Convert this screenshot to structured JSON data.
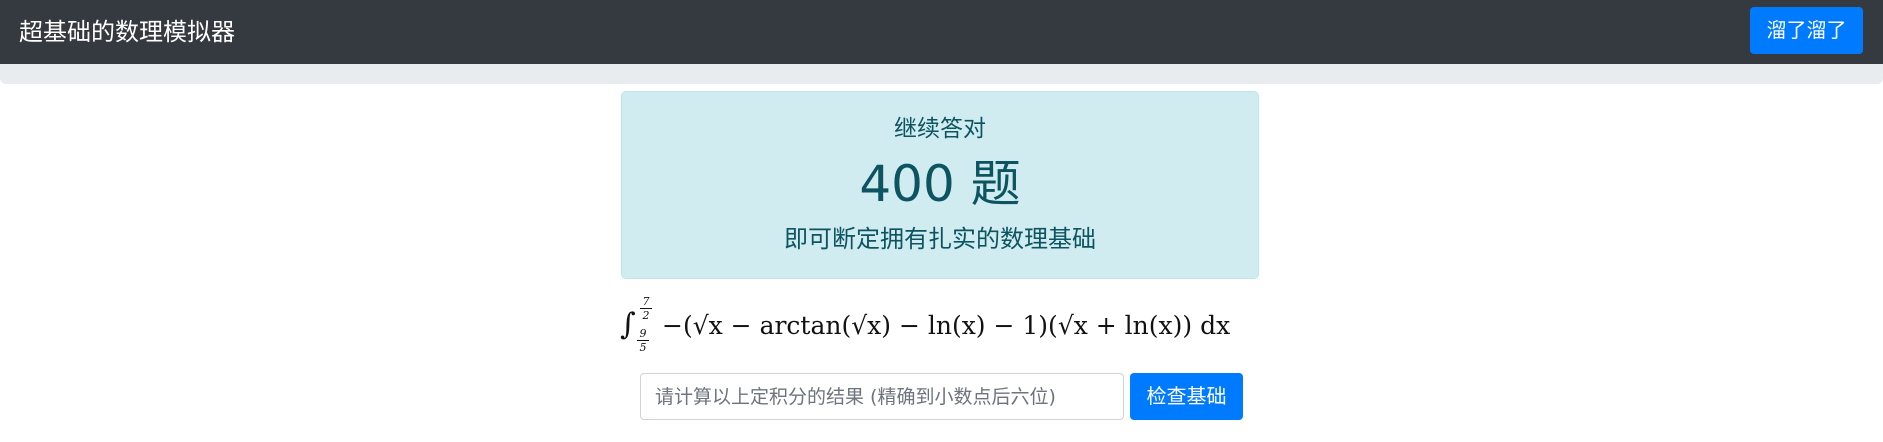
{
  "navbar": {
    "brand": "超基础的数理模拟器",
    "button_label": "溜了溜了"
  },
  "alert": {
    "line1": "继续答对",
    "count_text": "400 题",
    "line3": "即可断定拥有扎实的数理基础"
  },
  "formula": {
    "integral_sign": "∫",
    "upper_limit": {
      "numerator": "7",
      "denominator": "2"
    },
    "lower_limit": {
      "numerator": "9",
      "denominator": "5"
    },
    "integrand": "−(√x − arctan(√x) − ln(x) − 1)(√x + ln(x)) dx"
  },
  "answer": {
    "placeholder": "请计算以上定积分的结果 (精确到小数点后六位)",
    "value": ""
  },
  "check_button": {
    "label": "检查基础"
  },
  "colors": {
    "navbar_bg": "#343a40",
    "primary": "#007bff",
    "alert_bg": "#d1ecf1",
    "alert_text": "#0c5460",
    "subbar_bg": "#e9ecef"
  }
}
